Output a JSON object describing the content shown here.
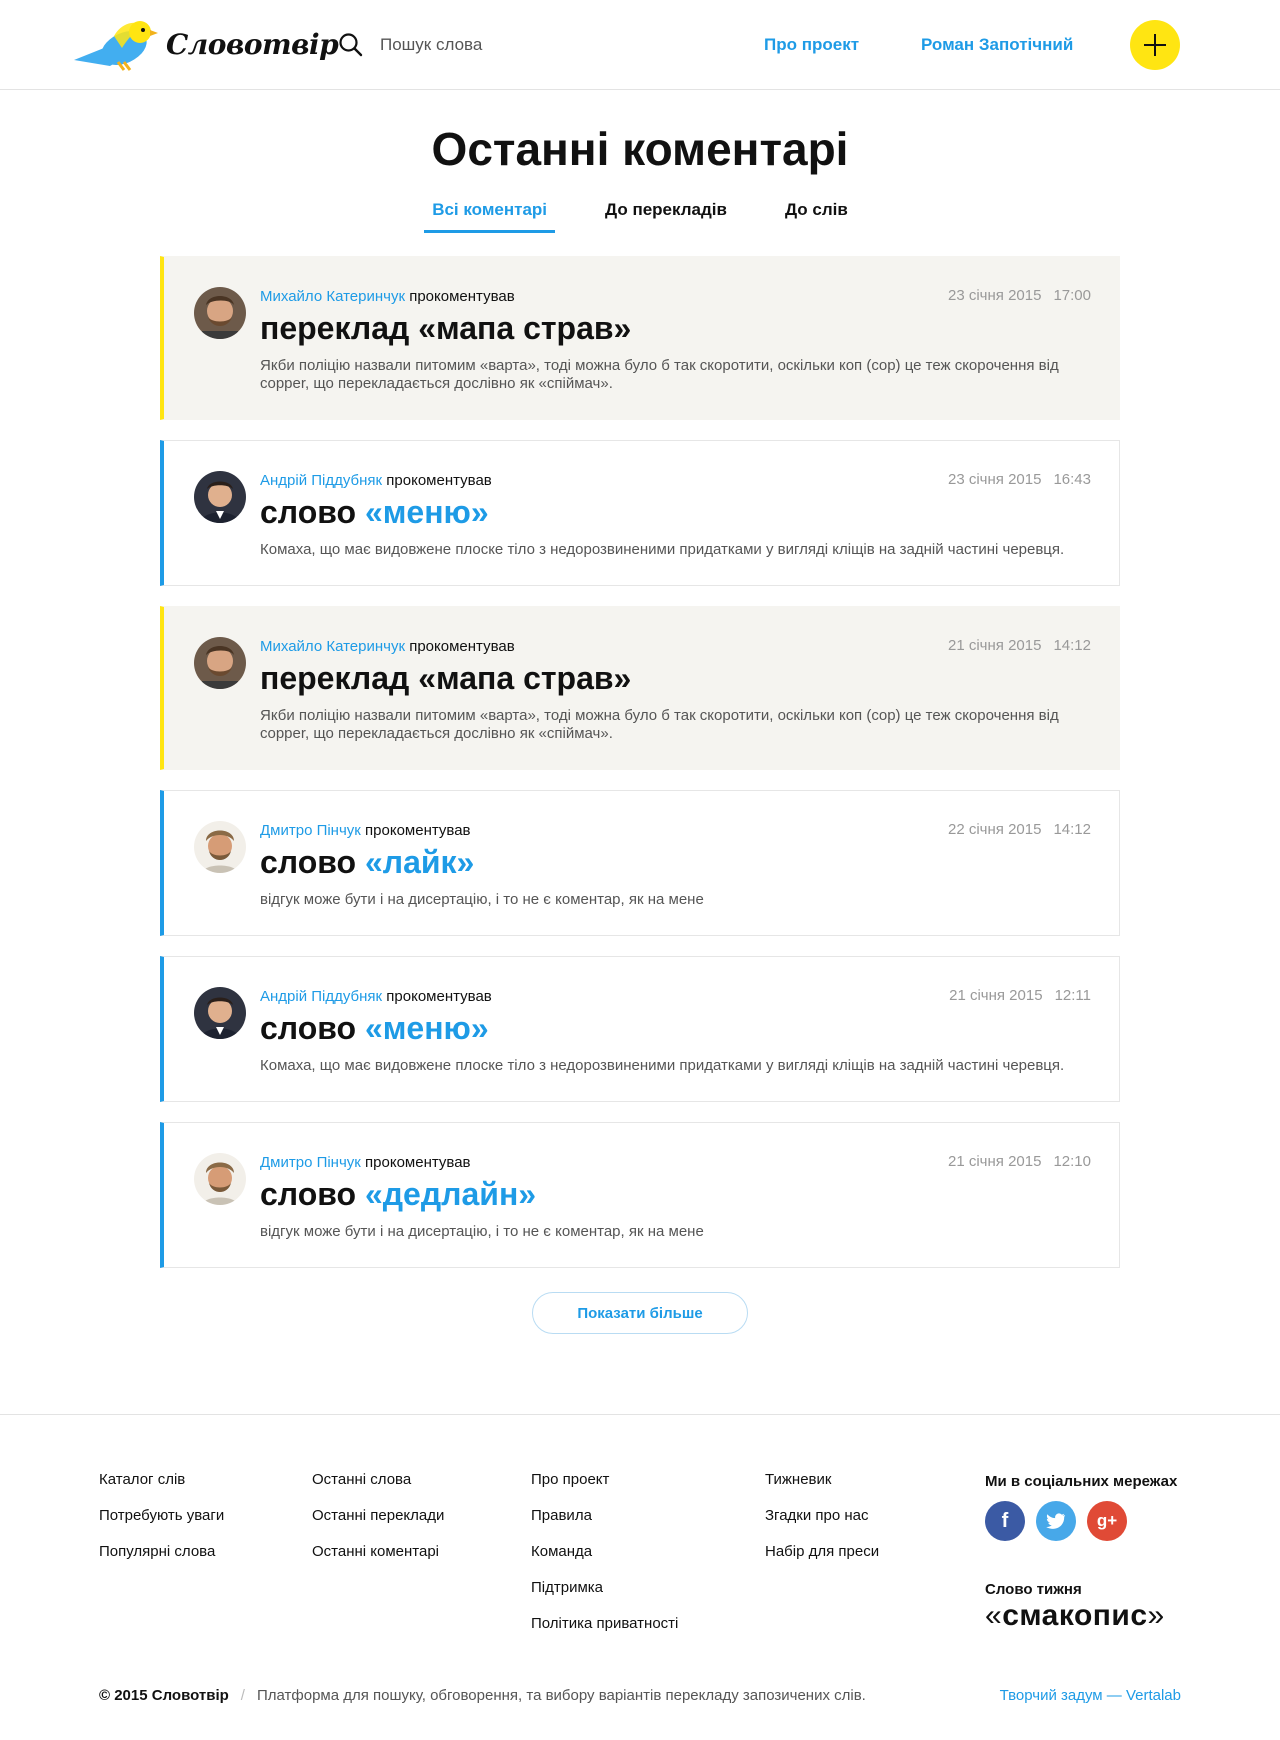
{
  "header": {
    "logo_text": "Словотвір",
    "search_placeholder": "Пошук слова",
    "nav": {
      "about": "Про проект",
      "user": "Роман Запотічний"
    },
    "add_label": "+"
  },
  "page": {
    "title": "Останні коментарі",
    "tabs": [
      "Всі коментарі",
      "До перекладів",
      "До слів"
    ],
    "active_tab": "Всі коментарі"
  },
  "comments": [
    {
      "type": "translation",
      "author": "Михайло Катеринчук",
      "action": "прокоментував",
      "date": "23 січня 2015",
      "time": "17:00",
      "kind": "переклад",
      "word": "«мапа страв»",
      "excerpt": "Якби поліцію назвали питомим «варта», тоді можна було б так скоротити, оскільки коп (cop) це теж скорочення від copper, що перекладається дослівно як «спіймач».",
      "avatar": "avatar-mykhailo"
    },
    {
      "type": "word",
      "author": "Андрій Піддубняк",
      "action": "прокоментував",
      "date": "23 січня 2015",
      "time": "16:43",
      "kind": "слово",
      "word": "«меню»",
      "excerpt": "Комаха, що має видовжене плоске тіло з недорозвиненими придатками у вигляді кліщів на задній частині черевця.",
      "avatar": "avatar-andrii"
    },
    {
      "type": "translation",
      "author": "Михайло Катеринчук",
      "action": "прокоментував",
      "date": "21 січня 2015",
      "time": "14:12",
      "kind": "переклад",
      "word": "«мапа страв»",
      "excerpt": "Якби поліцію назвали питомим «варта», тоді можна було б так скоротити, оскільки коп (cop) це теж скорочення від copper, що перекладається дослівно як «спіймач».",
      "avatar": "avatar-mykhailo"
    },
    {
      "type": "word",
      "author": "Дмитро Пінчук",
      "action": "прокоментував",
      "date": "22 січня 2015",
      "time": "14:12",
      "kind": "слово",
      "word": "«лайк»",
      "excerpt": "відгук може бути і на дисертацію, і то не є коментар, як на мене",
      "avatar": "avatar-dmytro"
    },
    {
      "type": "word",
      "author": "Андрій Піддубняк",
      "action": "прокоментував",
      "date": "21 січня 2015",
      "time": "12:11",
      "kind": "слово",
      "word": "«меню»",
      "excerpt": "Комаха, що має видовжене плоске тіло з недорозвиненими придатками у вигляді кліщів на задній частині черевця.",
      "avatar": "avatar-andrii"
    },
    {
      "type": "word",
      "author": "Дмитро Пінчук",
      "action": "прокоментував",
      "date": "21 січня 2015",
      "time": "12:10",
      "kind": "слово",
      "word": "«дедлайн»",
      "excerpt": "відгук може бути і на дисертацію, і то не є коментар, як на мене",
      "avatar": "avatar-dmytro"
    }
  ],
  "more_button": "Показати більше",
  "footer": {
    "col1": [
      "Каталог слів",
      "Потребують уваги",
      "Популярні слова"
    ],
    "col2": [
      "Останні слова",
      "Останні переклади",
      "Останні коментарі"
    ],
    "col3": [
      "Про проект",
      "Правила",
      "Команда",
      "Підтримка",
      "Політика приватності"
    ],
    "col4": [
      "Тижневик",
      "Згадки про нас",
      "Набір для преси"
    ],
    "social_title": "Ми в соціальних мережах",
    "social_icons": [
      "facebook-icon",
      "twitter-icon",
      "google-plus-icon"
    ],
    "word_of_week_label": "Слово тижня",
    "word_of_week": "смакопис",
    "copyright": "© 2015 Словотвір",
    "tagline": "Платформа для пошуку, обговорення, та вибору варіантів перекладу запозичених слів.",
    "credit": "Творчий задум — Vertalab"
  },
  "colors": {
    "accent": "#1e9be6",
    "yellow": "#ffe512",
    "translation_bg": "#f5f4f0"
  }
}
